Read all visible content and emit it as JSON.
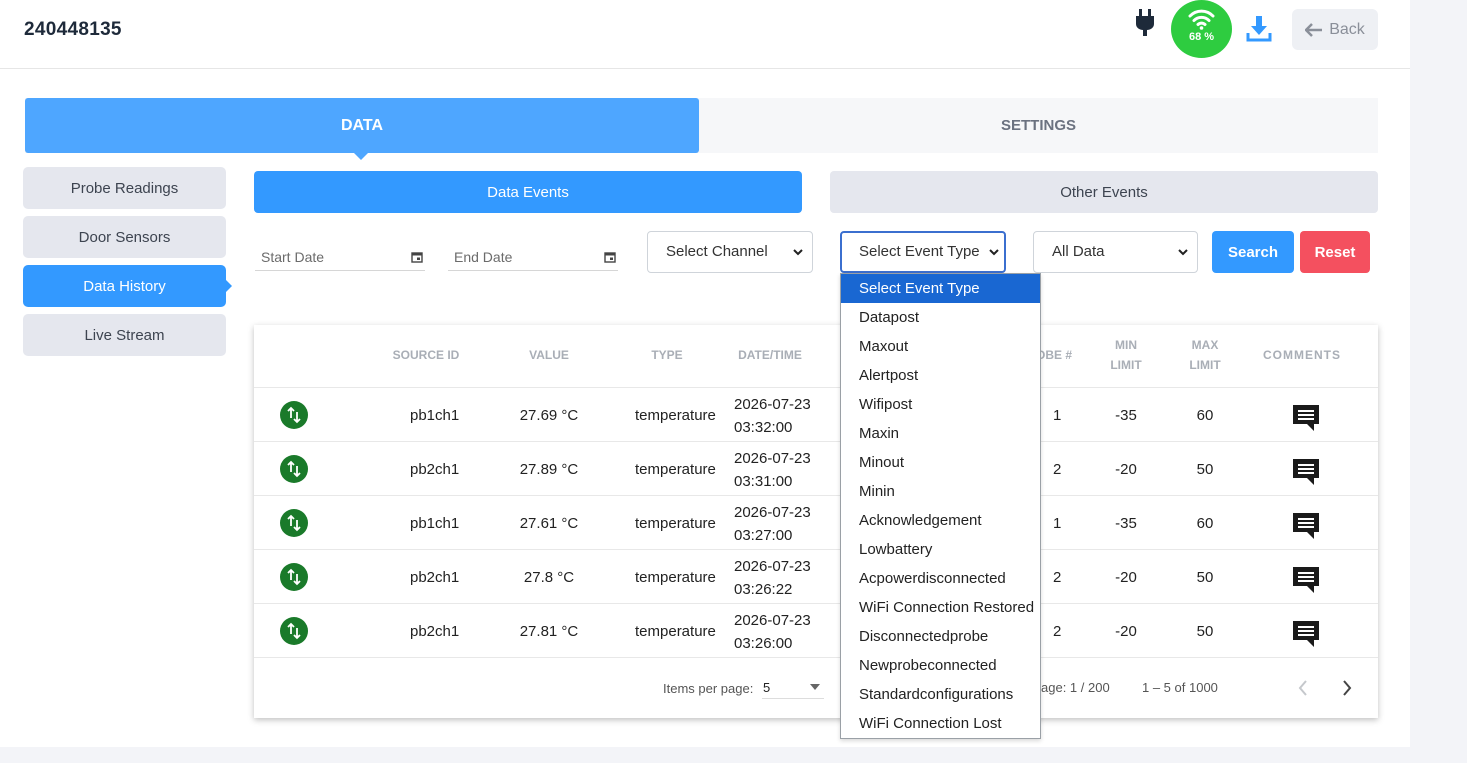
{
  "header": {
    "device_id": "240448135",
    "wifi_percent": "68 %",
    "back_label": "Back"
  },
  "tabs": {
    "data_label": "DATA",
    "settings_label": "SETTINGS"
  },
  "sidebar": {
    "items": [
      {
        "label": "Probe Readings"
      },
      {
        "label": "Door Sensors"
      },
      {
        "label": "Data History"
      },
      {
        "label": "Live Stream"
      }
    ]
  },
  "event_tabs": {
    "data_events": "Data Events",
    "other_events": "Other Events"
  },
  "filters": {
    "start_date": "Start Date",
    "end_date": "End Date",
    "channel": "Select Channel",
    "event_type": "Select Event Type",
    "data_scope": "All Data",
    "search_label": "Search",
    "reset_label": "Reset"
  },
  "table": {
    "headers": {
      "source_id": "SOURCE ID",
      "value": "VALUE",
      "type": "TYPE",
      "datetime": "DATE/TIME",
      "probe": "OBE #",
      "min_limit_1": "MIN",
      "min_limit_2": "LIMIT",
      "max_limit_1": "MAX",
      "max_limit_2": "LIMIT",
      "comments": "COMMENTS"
    },
    "rows": [
      {
        "source": "pb1ch1",
        "value": "27.69 °C",
        "type": "temperature",
        "date": "2026-07-23",
        "time": "03:32:00",
        "probe": "1",
        "min": "-35",
        "max": "60"
      },
      {
        "source": "pb2ch1",
        "value": "27.89 °C",
        "type": "temperature",
        "date": "2026-07-23",
        "time": "03:31:00",
        "probe": "2",
        "min": "-20",
        "max": "50"
      },
      {
        "source": "pb1ch1",
        "value": "27.61 °C",
        "type": "temperature",
        "date": "2026-07-23",
        "time": "03:27:00",
        "probe": "1",
        "min": "-35",
        "max": "60"
      },
      {
        "source": "pb2ch1",
        "value": "27.8 °C",
        "type": "temperature",
        "date": "2026-07-23",
        "time": "03:26:22",
        "probe": "2",
        "min": "-20",
        "max": "50"
      },
      {
        "source": "pb2ch1",
        "value": "27.81 °C",
        "type": "temperature",
        "date": "2026-07-23",
        "time": "03:26:00",
        "probe": "2",
        "min": "-20",
        "max": "50"
      }
    ]
  },
  "pagination": {
    "items_per_page_label": "Items per page:",
    "items_per_page_value": "5",
    "page_text": "age: 1 / 200",
    "range_text": "1 – 5 of 1000"
  },
  "event_type_options": [
    "Select Event Type",
    "Datapost",
    "Maxout",
    "Alertpost",
    "Wifipost",
    "Maxin",
    "Minout",
    "Minin",
    "Acknowledgement",
    "Lowbattery",
    "Acpowerdisconnected",
    "WiFi Connection Restored",
    "Disconnectedprobe",
    "Newprobeconnected",
    "Standardconfigurations",
    "WiFi Connection Lost"
  ],
  "colors": {
    "primary": "#3399ff",
    "tab_active": "#4ea6ff",
    "reset": "#f4505f",
    "wifi_badge": "#2ecc40",
    "status_ok": "#1a7a2a"
  }
}
